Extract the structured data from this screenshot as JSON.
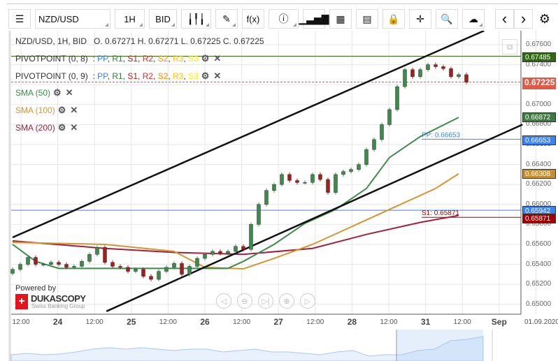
{
  "toolbar": {
    "symbol": "NZD/USD",
    "timeframe": "1H",
    "side": "BID",
    "icons": [
      "menu-icon",
      "candlestick-icon",
      "pencil-icon",
      "function-icon",
      "info-icon",
      "bar-chart-icon",
      "calendar-icon",
      "news-icon",
      "lock-icon",
      "crosshair-icon",
      "zoom-chart-icon",
      "cloud-upload-icon",
      "chevron-left-icon",
      "chevron-right-icon",
      "gear-icon"
    ],
    "fx": "f(x)"
  },
  "ohlc": {
    "title": "NZD/USD, 1H, BID",
    "text": "O. 0.67271 H. 0.67271 L. 0.67225 C. 0.67225"
  },
  "indicators": [
    {
      "name": "PIVOTPOINT (0, 8)",
      "sep": ":"
    },
    {
      "name": "PIVOTPOINT (0, 9)",
      "sep": ":"
    },
    {
      "name": "SMA (50)",
      "color": "#3d8b4a"
    },
    {
      "name": "SMA (100)",
      "color": "#d4952f"
    },
    {
      "name": "SMA (200)",
      "color": "#a3203a"
    }
  ],
  "pivot_levels": [
    {
      "t": "PP",
      "c": "#3b82f6"
    },
    {
      "t": "R1",
      "c": "#2e7d32"
    },
    {
      "t": "S1",
      "c": "#b71c1c"
    },
    {
      "t": "R2",
      "c": "#ff2020"
    },
    {
      "t": "S2",
      "c": "#ff8c00"
    },
    {
      "t": "R3",
      "c": "#ffc107"
    },
    {
      "t": "S3",
      "c": "#ffee00"
    }
  ],
  "y_axis": {
    "min": 0.6495,
    "max": 0.6778,
    "ticks": [
      "0.67600",
      "0.67400",
      "0.67200",
      "0.67000",
      "0.66800",
      "0.66600",
      "0.66400",
      "0.66200",
      "0.66000",
      "0.65800",
      "0.65600",
      "0.65400",
      "0.65200",
      "0.65000"
    ]
  },
  "x_axis": {
    "labels": [
      "12:00",
      "24",
      "12:00",
      "25",
      "12:00",
      "26",
      "12:00",
      "27",
      "12:00",
      "28",
      "12:00",
      "31",
      "12:00",
      "Sep"
    ],
    "date": "01.09.2020"
  },
  "price_labels": [
    {
      "value": "0.67485",
      "color": "#2e6b10"
    },
    {
      "value": "0.67225",
      "color": "#e05a47"
    },
    {
      "value": "0.66872",
      "color": "#3d7b40"
    },
    {
      "value": "0.66653",
      "color": "#3b82f6"
    },
    {
      "value": "0.66308",
      "color": "#c8902c"
    },
    {
      "value": "0.65942",
      "color": "#3b82f6"
    },
    {
      "value": "0.65871",
      "color": "#a00000"
    }
  ],
  "pivot_annotations": {
    "pp": "PP: 0.66653",
    "s1": "S1: 0.65871"
  },
  "chart_data": {
    "type": "candlestick",
    "closes": [
      0.6535,
      0.654,
      0.6547,
      0.654,
      0.654,
      0.6542,
      0.654,
      0.6537,
      0.6538,
      0.6543,
      0.655,
      0.6557,
      0.6542,
      0.6538,
      0.6537,
      0.6533,
      0.6535,
      0.6528,
      0.6525,
      0.6533,
      0.6537,
      0.6541,
      0.653,
      0.6538,
      0.6546,
      0.655,
      0.6553,
      0.6551,
      0.6553,
      0.6558,
      0.6555,
      0.658,
      0.66,
      0.6614,
      0.662,
      0.663,
      0.6624,
      0.6622,
      0.6622,
      0.663,
      0.6625,
      0.6612,
      0.663,
      0.6633,
      0.6635,
      0.664,
      0.6655,
      0.6665,
      0.668,
      0.6695,
      0.6718,
      0.6735,
      0.6728,
      0.6735,
      0.674,
      0.6738,
      0.6736,
      0.6728,
      0.673,
      0.67225
    ],
    "sma50": [
      [
        0,
        0.656
      ],
      [
        3,
        0.6543
      ],
      [
        6,
        0.6536
      ],
      [
        12,
        0.6536
      ],
      [
        21,
        0.6536
      ],
      [
        28,
        0.6536
      ],
      [
        30,
        0.6543
      ],
      [
        34,
        0.656
      ],
      [
        38,
        0.6581
      ],
      [
        42,
        0.6595
      ],
      [
        46,
        0.6616
      ],
      [
        49,
        0.6647
      ],
      [
        53,
        0.6668
      ],
      [
        58,
        0.66872
      ]
    ],
    "sma100": [
      [
        0,
        0.6562
      ],
      [
        12,
        0.656
      ],
      [
        21,
        0.6553
      ],
      [
        25,
        0.6537
      ],
      [
        30,
        0.65355
      ],
      [
        34,
        0.6546
      ],
      [
        39,
        0.656
      ],
      [
        44,
        0.65775
      ],
      [
        49,
        0.6595
      ],
      [
        55,
        0.6616
      ],
      [
        58,
        0.66308
      ]
    ],
    "sma200": [
      [
        0,
        0.65635
      ],
      [
        12,
        0.6556
      ],
      [
        21,
        0.6552
      ],
      [
        30,
        0.655
      ],
      [
        39,
        0.6556
      ],
      [
        46,
        0.657
      ],
      [
        53,
        0.6582
      ],
      [
        58,
        0.6589
      ]
    ],
    "horizontal_lines": {
      "r_level": 0.67485,
      "last_price": 0.67225,
      "blue_level": 0.65942,
      "pp": 0.66653,
      "s1": 0.65871
    },
    "trend_lines": [
      [
        [
          0,
          0.6567
        ],
        [
          61.3,
          0.6774
        ]
      ],
      [
        [
          12.2,
          0.6493
        ],
        [
          66.3,
          0.668
        ]
      ]
    ]
  },
  "navigator": [
    0.652,
    0.653,
    0.652,
    0.6525,
    0.654,
    0.656,
    0.657,
    0.656,
    0.657,
    0.656,
    0.655,
    0.656,
    0.656,
    0.654,
    0.655,
    0.656,
    0.654,
    0.654,
    0.653,
    0.652,
    0.654,
    0.655,
    0.651,
    0.652,
    0.652,
    0.655,
    0.656,
    0.662,
    0.663,
    0.665
  ],
  "branding": {
    "powered": "Powered by",
    "name": "DUKASCOPY",
    "sub": "Swiss Banking Group"
  }
}
